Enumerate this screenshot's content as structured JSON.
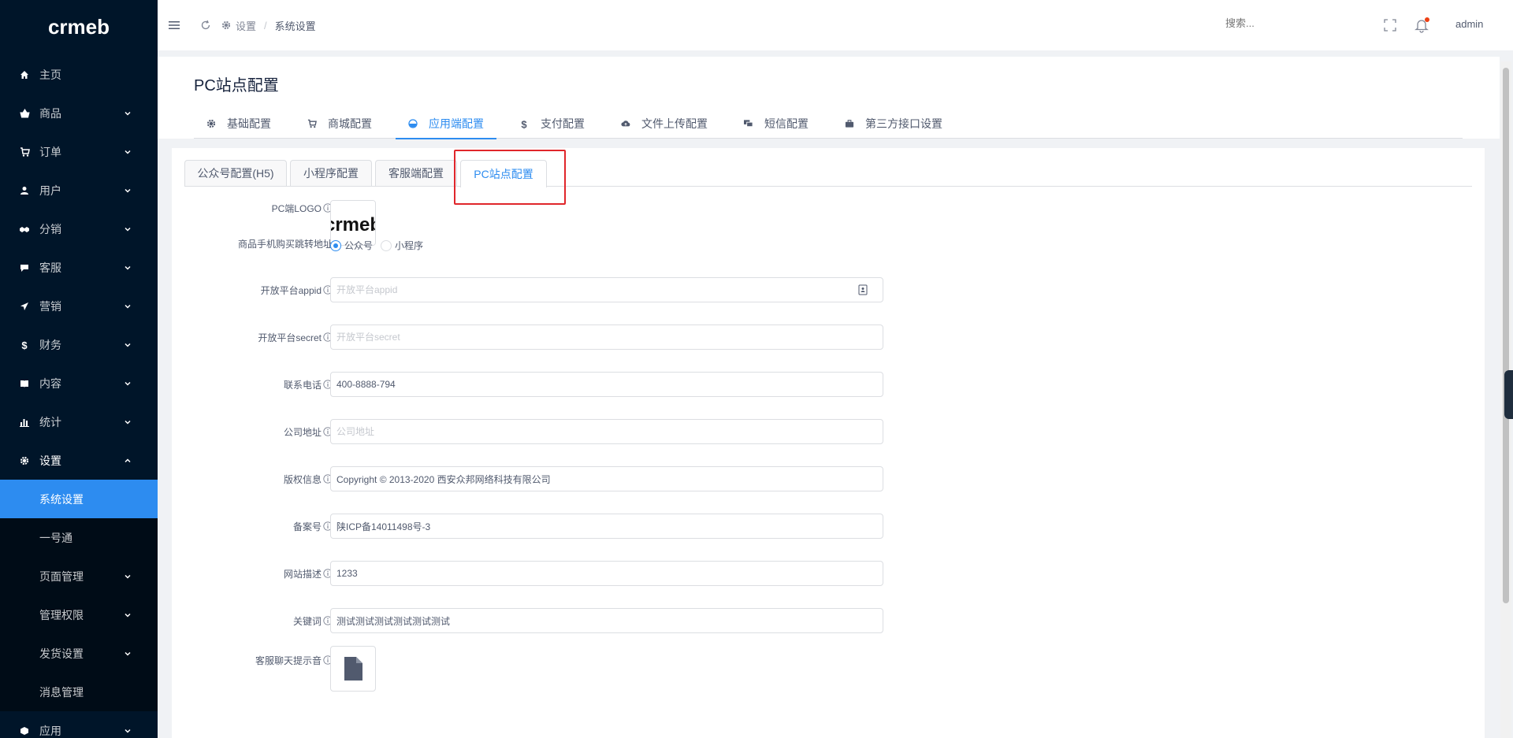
{
  "brand": {
    "logo_text": "crmeb",
    "accent": "#2d8cf0",
    "sidebar_bg": "#001529"
  },
  "sidebar": {
    "items": [
      {
        "label": "主页",
        "icon": "home-icon",
        "chevron": false
      },
      {
        "label": "商品",
        "icon": "basket-icon",
        "chevron": true
      },
      {
        "label": "订单",
        "icon": "cart-icon",
        "chevron": true
      },
      {
        "label": "用户",
        "icon": "user-icon",
        "chevron": true
      },
      {
        "label": "分销",
        "icon": "handshake-icon",
        "chevron": true
      },
      {
        "label": "客服",
        "icon": "chat-icon",
        "chevron": true
      },
      {
        "label": "营销",
        "icon": "send-icon",
        "chevron": true
      },
      {
        "label": "财务",
        "icon": "dollar-icon",
        "chevron": true
      },
      {
        "label": "内容",
        "icon": "book-icon",
        "chevron": true
      },
      {
        "label": "统计",
        "icon": "bar-chart-icon",
        "chevron": true
      },
      {
        "label": "设置",
        "icon": "gear-icon",
        "chevron": true
      }
    ],
    "settings_sub": [
      {
        "label": "系统设置",
        "active": true
      },
      {
        "label": "一号通"
      },
      {
        "label": "页面管理",
        "chevron": true
      },
      {
        "label": "管理权限",
        "chevron": true
      },
      {
        "label": "发货设置",
        "chevron": true
      },
      {
        "label": "消息管理"
      }
    ],
    "last_item": {
      "label": "应用",
      "icon": "cube-icon"
    }
  },
  "header": {
    "breadcrumb_root": "设置",
    "breadcrumb_sep": "/",
    "breadcrumb_current": "系统设置",
    "search_placeholder": "搜索...",
    "user": "admin"
  },
  "page": {
    "title": "PC站点配置",
    "tabs": [
      {
        "label": "基础配置",
        "icon": "gear-icon"
      },
      {
        "label": "商城配置",
        "icon": "cart-icon"
      },
      {
        "label": "应用端配置",
        "icon": "app-icon",
        "active": true
      },
      {
        "label": "支付配置",
        "icon": "dollar-icon"
      },
      {
        "label": "文件上传配置",
        "icon": "cloud-upload-icon"
      },
      {
        "label": "短信配置",
        "icon": "sms-icon"
      },
      {
        "label": "第三方接口设置",
        "icon": "briefcase-icon"
      }
    ],
    "subtabs": [
      {
        "label": "公众号配置(H5)"
      },
      {
        "label": "小程序配置"
      },
      {
        "label": "客服端配置"
      },
      {
        "label": "PC站点配置",
        "active": true
      }
    ]
  },
  "form": {
    "logo": {
      "label": "PC端LOGO",
      "logo_text": "crmeb"
    },
    "redirect": {
      "label": "商品手机购买跳转地址",
      "options": [
        "公众号",
        "小程序"
      ],
      "selected": "公众号"
    },
    "appid": {
      "label": "开放平台appid",
      "value": "",
      "placeholder": "开放平台appid"
    },
    "secret": {
      "label": "开放平台secret",
      "value": "",
      "placeholder": "开放平台secret"
    },
    "phone": {
      "label": "联系电话",
      "value": "400-8888-794",
      "placeholder": ""
    },
    "address": {
      "label": "公司地址",
      "value": "",
      "placeholder": "公司地址"
    },
    "copyright": {
      "label": "版权信息",
      "value": "Copyright © 2013-2020 西安众邦网络科技有限公司",
      "placeholder": ""
    },
    "icp": {
      "label": "备案号",
      "value": "陕ICP备14011498号-3",
      "placeholder": ""
    },
    "description": {
      "label": "网站描述",
      "value": "1233",
      "placeholder": ""
    },
    "keywords": {
      "label": "关键词",
      "value": "测试测试测试测试测试测试",
      "placeholder": ""
    },
    "chat_sound": {
      "label": "客服聊天提示音",
      "icon": "file-icon"
    }
  }
}
